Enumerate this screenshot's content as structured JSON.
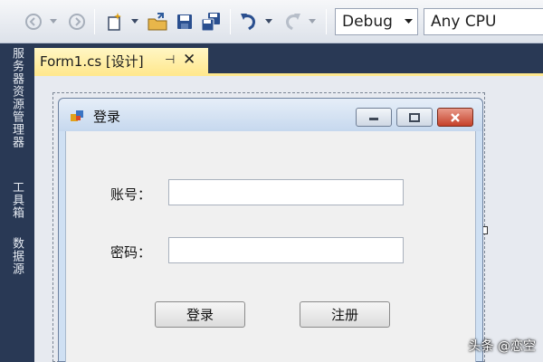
{
  "toolbar": {
    "configuration": "Debug",
    "platform": "Any CPU",
    "icons": [
      "back-icon",
      "forward-icon",
      "new-project-icon",
      "open-icon",
      "save-icon",
      "save-all-icon",
      "undo-icon",
      "redo-icon"
    ]
  },
  "tool_windows": [
    "服务器资源管理器",
    "工具箱",
    "数据源"
  ],
  "document_tab": {
    "title": "Form1.cs [设计]",
    "pin_glyph": "⊣",
    "close_glyph": "✕"
  },
  "form": {
    "title": "登录",
    "account_label": "账号：",
    "password_label": "密码：",
    "account_value": "",
    "password_value": "",
    "login_button": "登录",
    "register_button": "注册"
  },
  "watermark": "头条 @恋空",
  "colors": {
    "ide_background": "#293955",
    "active_tab": "#ffe88f",
    "close_button": "#c5412a"
  }
}
